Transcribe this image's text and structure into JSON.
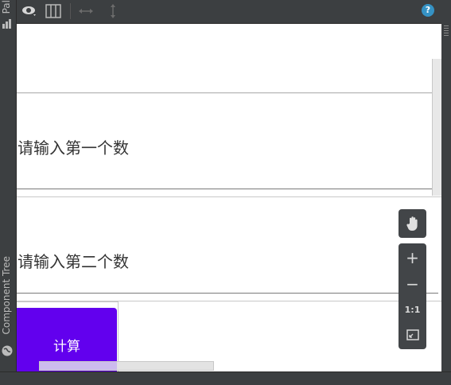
{
  "left_panel": {
    "palette_tab": "Pal",
    "component_tree_tab": "Component Tree"
  },
  "toolbar": {
    "icons": [
      "eye-icon",
      "blueprint-icon",
      "resize-horizontal-icon",
      "resize-vertical-icon",
      "help-icon"
    ],
    "help_glyph": "?"
  },
  "canvas": {
    "input_first_hint": "请输入第一个数",
    "input_second_hint": "请输入第二个数",
    "calculate_button": "计算"
  },
  "zoom_controls": {
    "pan": "hand-icon",
    "zoom_in": "+",
    "zoom_out": "−",
    "actual_size": "1:1",
    "fit_screen": "fit-screen-icon"
  },
  "colors": {
    "ide_background": "#3c3f41",
    "canvas_background": "#ffffff",
    "button_accent": "#6200ee",
    "help_blue": "#3592c4"
  }
}
